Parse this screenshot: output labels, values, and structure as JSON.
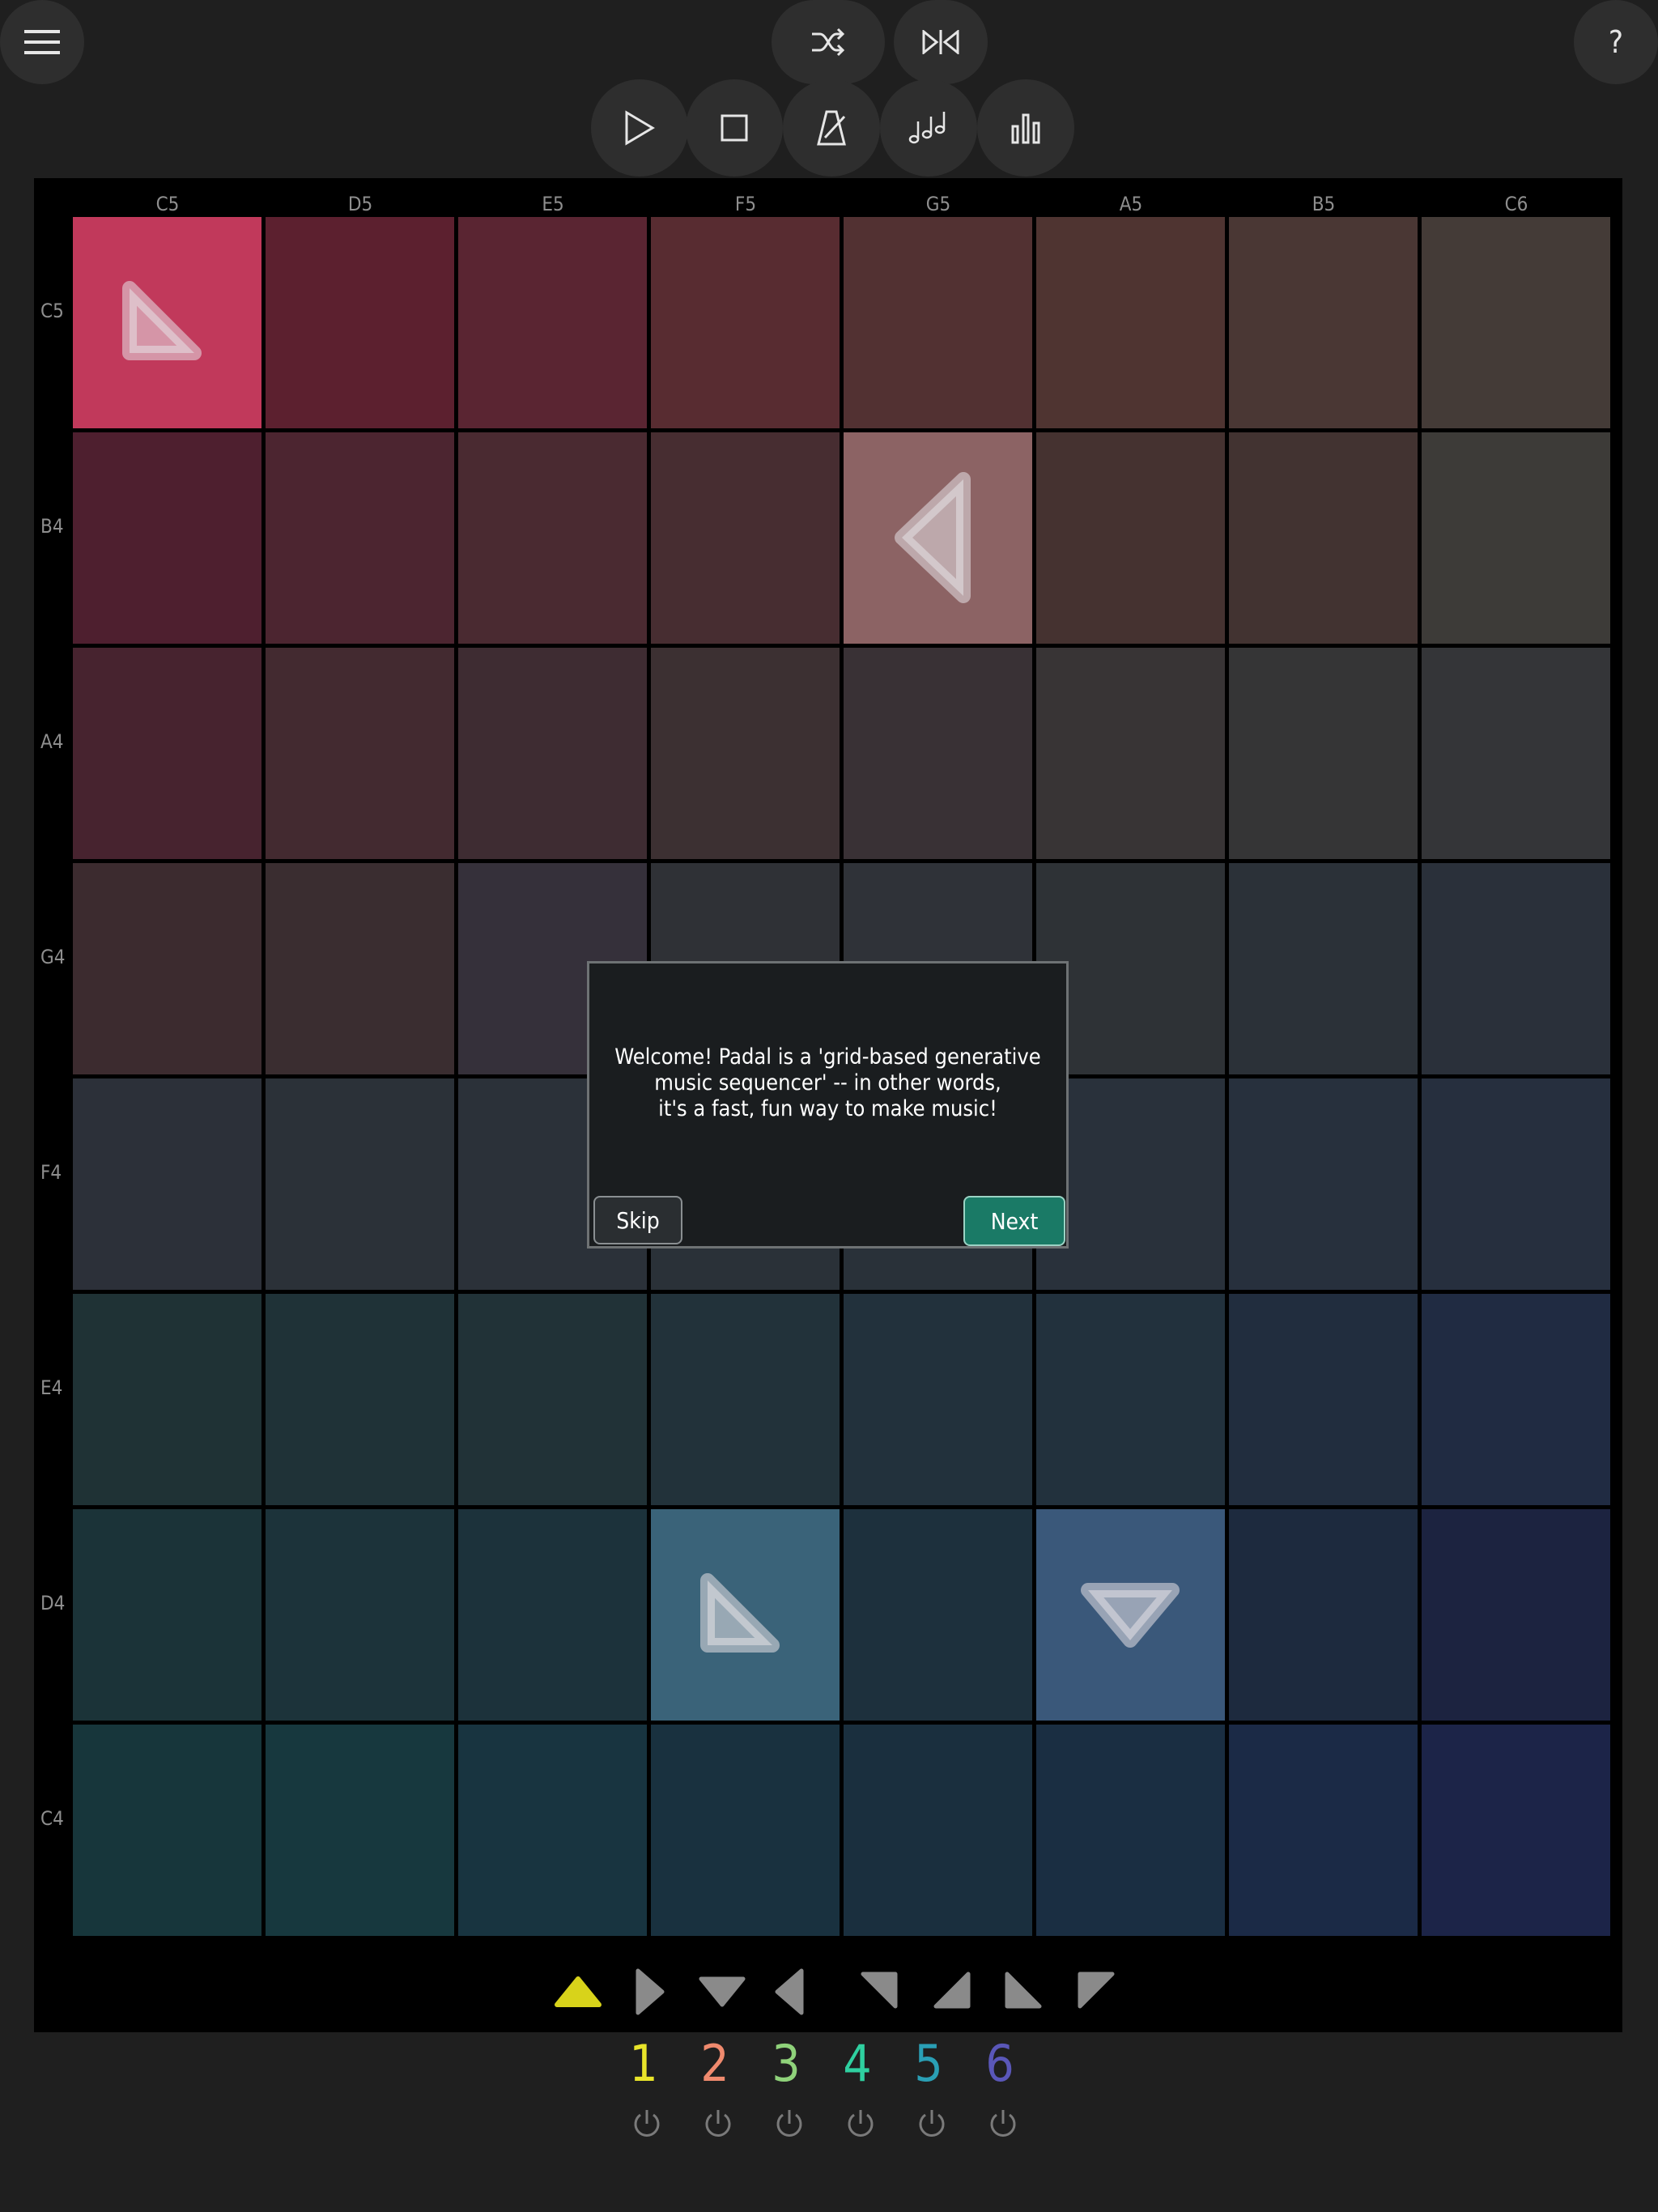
{
  "toolbar": {
    "menu_icon": "hamburger-icon",
    "shuffle_icon": "shuffle-icon",
    "mirror_icon": "mirror-icon",
    "help_label": "?",
    "transport": [
      "play-icon",
      "stop-icon",
      "metronome-icon",
      "notes-icon",
      "levels-icon"
    ]
  },
  "grid": {
    "columns": [
      "C5",
      "D5",
      "E5",
      "F5",
      "G5",
      "A5",
      "B5",
      "C6"
    ],
    "rows": [
      "C5",
      "B4",
      "A4",
      "G4",
      "F4",
      "E4",
      "D4",
      "C4"
    ],
    "colors": [
      [
        "#c1395b",
        "#5c202f",
        "#5a2532",
        "#582c31",
        "#523132",
        "#4f3431",
        "#4a3734",
        "#443b37"
      ],
      [
        "#4e1f2f",
        "#4c2530",
        "#4a2a31",
        "#472d31",
        "#8c6364",
        "#453230",
        "#423331",
        "#3d3b38"
      ],
      [
        "#47232f",
        "#432a30",
        "#3e2c32",
        "#3c3032",
        "#393135",
        "#383435",
        "#353536",
        "#343538"
      ],
      [
        "#3c2b2f",
        "#3a2d30",
        "#35303a",
        "#2f3136",
        "#2f3238",
        "#2e3236",
        "#2b3138",
        "#2a303a"
      ],
      [
        "#2c3039",
        "#2b3138",
        "#2b3139",
        "#2a3138",
        "#293139",
        "#29313b",
        "#27303d",
        "#262f3e"
      ],
      [
        "#1f3235",
        "#1f3237",
        "#213237",
        "#22323a",
        "#22313c",
        "#22313d",
        "#212d3e",
        "#202b42"
      ],
      [
        "#1b3338",
        "#1c333a",
        "#1c323b",
        "#3a6379",
        "#1d303d",
        "#3a587a",
        "#1d2a3e",
        "#1c2340"
      ],
      [
        "#17363b",
        "#17383e",
        "#183440",
        "#19313f",
        "#1a2f3e",
        "#1a2e42",
        "#1b2a46",
        "#1c2448"
      ]
    ],
    "arrows": [
      {
        "row": 0,
        "col": 0,
        "direction": "down-right"
      },
      {
        "row": 1,
        "col": 4,
        "direction": "left"
      },
      {
        "row": 6,
        "col": 3,
        "direction": "down-right"
      },
      {
        "row": 6,
        "col": 5,
        "direction": "down"
      }
    ]
  },
  "palette": {
    "selected": "up",
    "arrows": [
      "up",
      "right",
      "down",
      "left",
      "up-left",
      "down-right-corner",
      "up-right-corner",
      "down-left-corner"
    ],
    "selected_color": "#d8d31a",
    "color": "#8a8a8a"
  },
  "channels": [
    {
      "label": "1",
      "color": "#e8e42a"
    },
    {
      "label": "2",
      "color": "#ef8a6e"
    },
    {
      "label": "3",
      "color": "#8fd27a"
    },
    {
      "label": "4",
      "color": "#2fd0a0"
    },
    {
      "label": "5",
      "color": "#2a9fb5"
    },
    {
      "label": "6",
      "color": "#5a57b8"
    }
  ],
  "dialog": {
    "message": "Welcome! Padal is a 'grid-based generative\nmusic sequencer' -- in other words,\nit's a fast, fun way to make music!",
    "skip_label": "Skip",
    "next_label": "Next"
  }
}
